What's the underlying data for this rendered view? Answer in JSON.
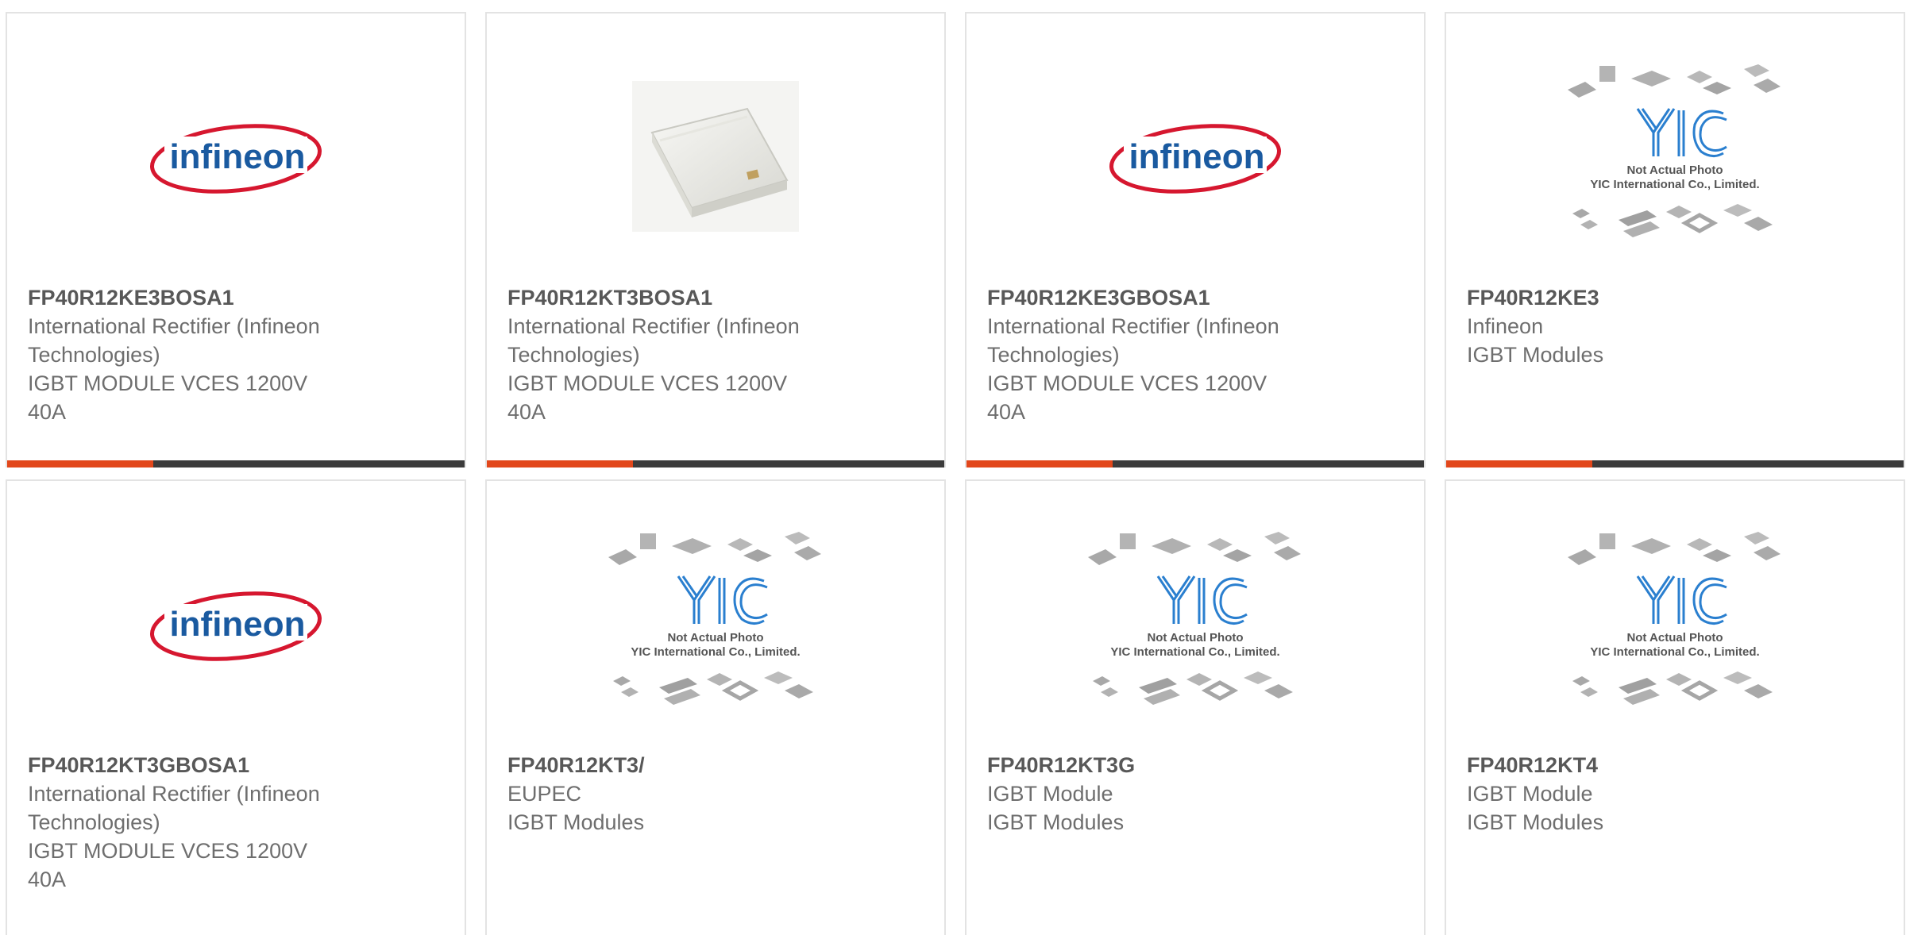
{
  "colors": {
    "accent": "#e2471b",
    "bar_dark": "#3b3b3b",
    "logo_red": "#d6172f",
    "logo_blue": "#1a5aa0",
    "yic_blue": "#2a7fcf"
  },
  "watermark": {
    "line1": "Not Actual Photo",
    "line2": "YIC International Co., Limited."
  },
  "logo_text": "infineon",
  "products": [
    {
      "part": "FP40R12KE3BOSA1",
      "lines": [
        "International Rectifier (Infineon",
        "Technologies)",
        "IGBT MODULE VCES 1200V",
        "40A"
      ],
      "image": "infineon-logo",
      "progress": 0.32
    },
    {
      "part": "FP40R12KT3BOSA1",
      "lines": [
        "International Rectifier (Infineon",
        "Technologies)",
        "IGBT MODULE VCES 1200V",
        "40A"
      ],
      "image": "module-photo",
      "progress": 0.32
    },
    {
      "part": "FP40R12KE3GBOSA1",
      "lines": [
        "International Rectifier (Infineon",
        "Technologies)",
        "IGBT MODULE VCES 1200V",
        "40A"
      ],
      "image": "infineon-logo",
      "progress": 0.32
    },
    {
      "part": "FP40R12KE3",
      "lines": [
        "Infineon",
        "IGBT Modules"
      ],
      "image": "not-actual-photo",
      "progress": 0.32
    },
    {
      "part": "FP40R12KT3GBOSA1",
      "lines": [
        "International Rectifier (Infineon",
        "Technologies)",
        "IGBT MODULE VCES 1200V",
        "40A"
      ],
      "image": "infineon-logo",
      "progress": 0
    },
    {
      "part": "FP40R12KT3/",
      "lines": [
        "EUPEC",
        "IGBT Modules"
      ],
      "image": "not-actual-photo",
      "progress": 0
    },
    {
      "part": "FP40R12KT3G",
      "lines": [
        "IGBT Module",
        "IGBT Modules"
      ],
      "image": "not-actual-photo",
      "progress": 0
    },
    {
      "part": "FP40R12KT4",
      "lines": [
        "IGBT Module",
        "IGBT Modules"
      ],
      "image": "not-actual-photo",
      "progress": 0
    }
  ]
}
